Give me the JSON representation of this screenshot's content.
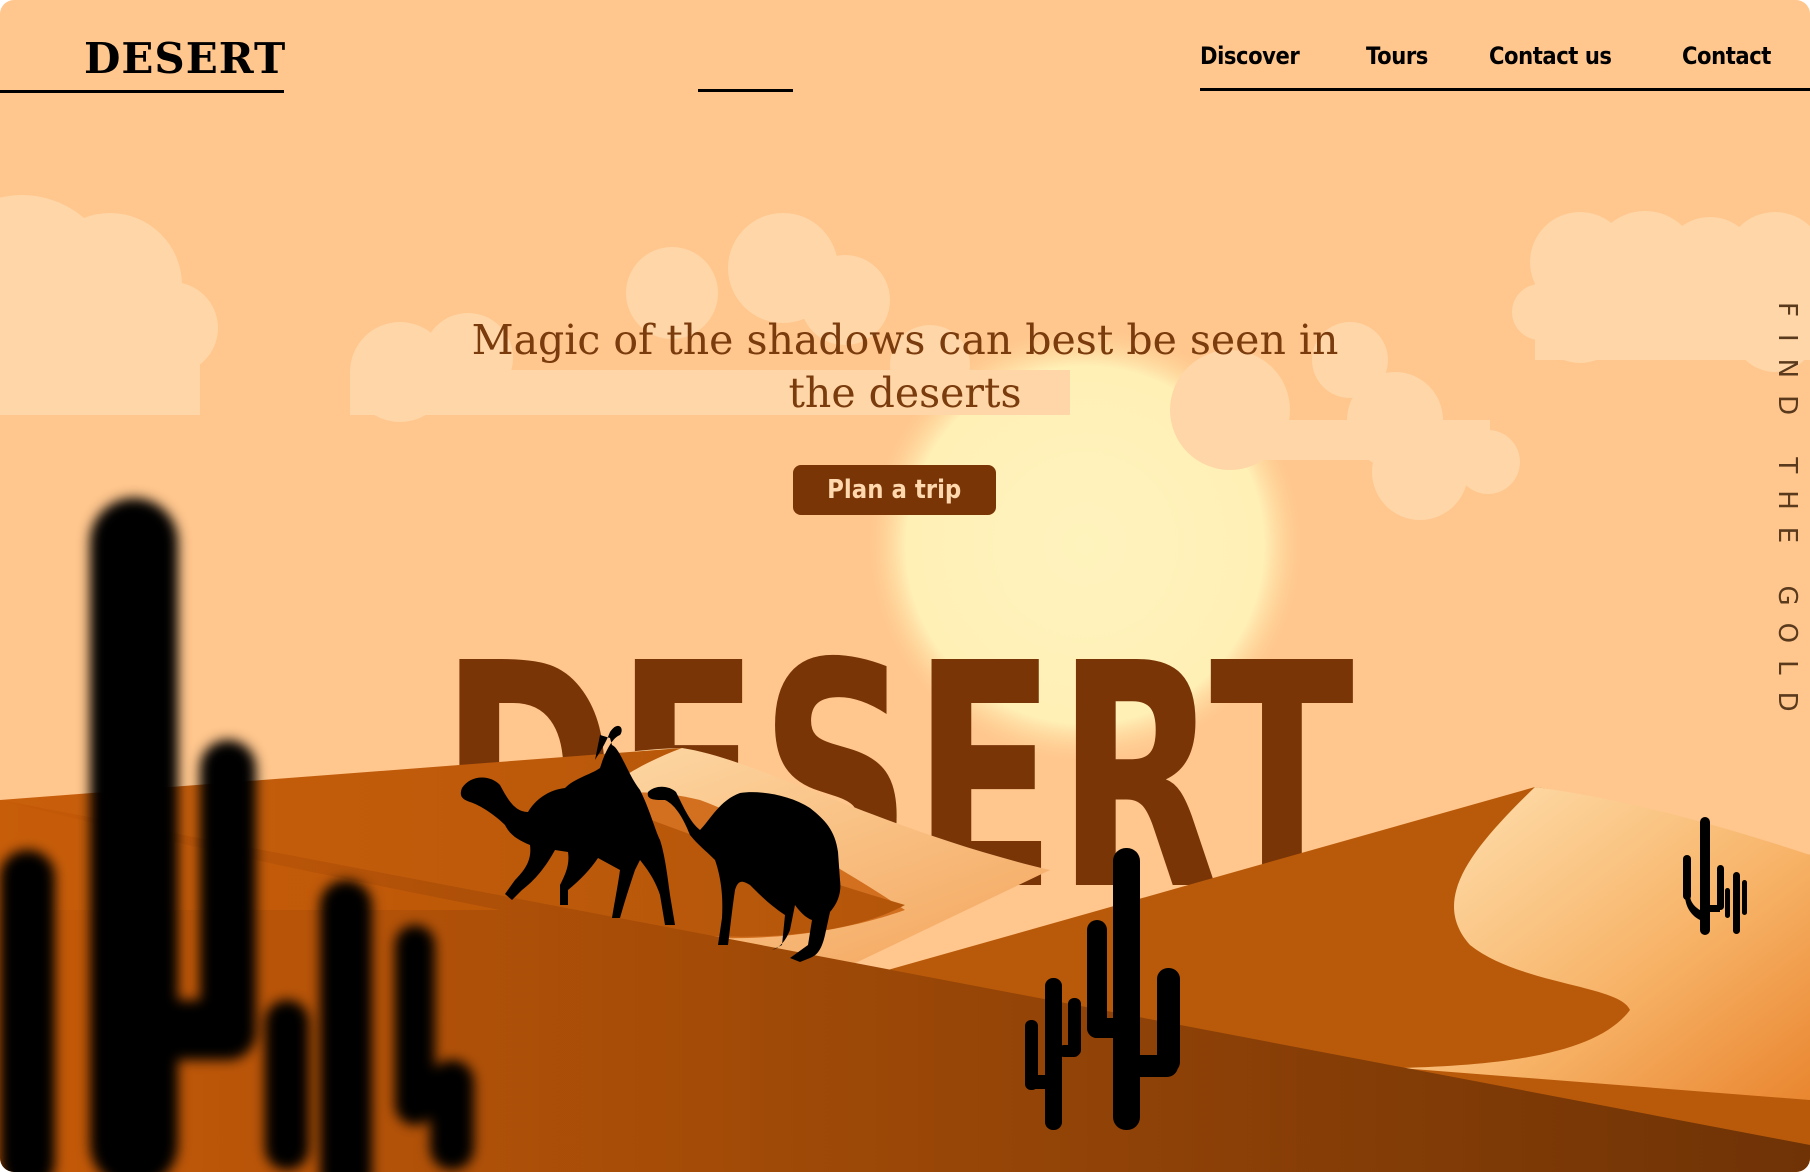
{
  "brand": {
    "name": "DESERT"
  },
  "nav": {
    "items": [
      {
        "label": "Discover"
      },
      {
        "label": "Tours"
      },
      {
        "label": "Contact us"
      },
      {
        "label": "Contact"
      }
    ]
  },
  "hero": {
    "tagline": "Magic of the shadows can best be seen in the deserts",
    "cta_label": "Plan a trip",
    "big_title": "DESERT",
    "side_text": "FIND THE GOLD"
  },
  "colors": {
    "sky": "#ffc68d",
    "accent_brown": "#7a3506",
    "sun": "#fff1b8",
    "dune_light": "#ffd9a6",
    "dune_mid": "#c55a0a",
    "dune_dark": "#7c3807"
  },
  "icons": [
    "camel-icon",
    "cactus-icon",
    "cloud-icon",
    "sun-icon"
  ]
}
